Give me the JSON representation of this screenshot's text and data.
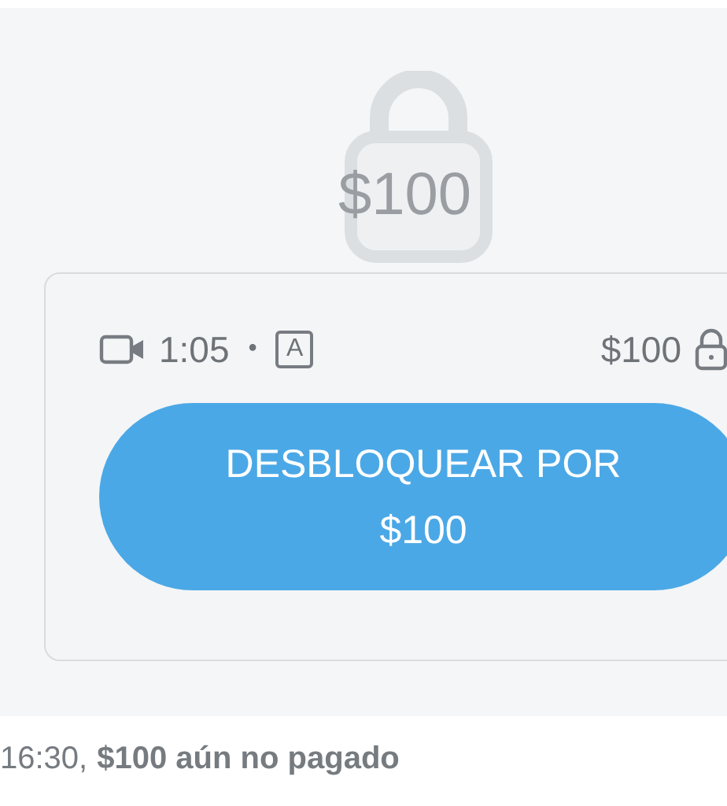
{
  "preview": {
    "price": "$100"
  },
  "meta": {
    "duration": "1:05",
    "separator": "•",
    "caption_badge": "A",
    "price": "$100"
  },
  "unlock_button": {
    "label": "DESBLOQUEAR POR $100"
  },
  "footer": {
    "time": "16:30,",
    "status": "$100 aún no pagado"
  }
}
